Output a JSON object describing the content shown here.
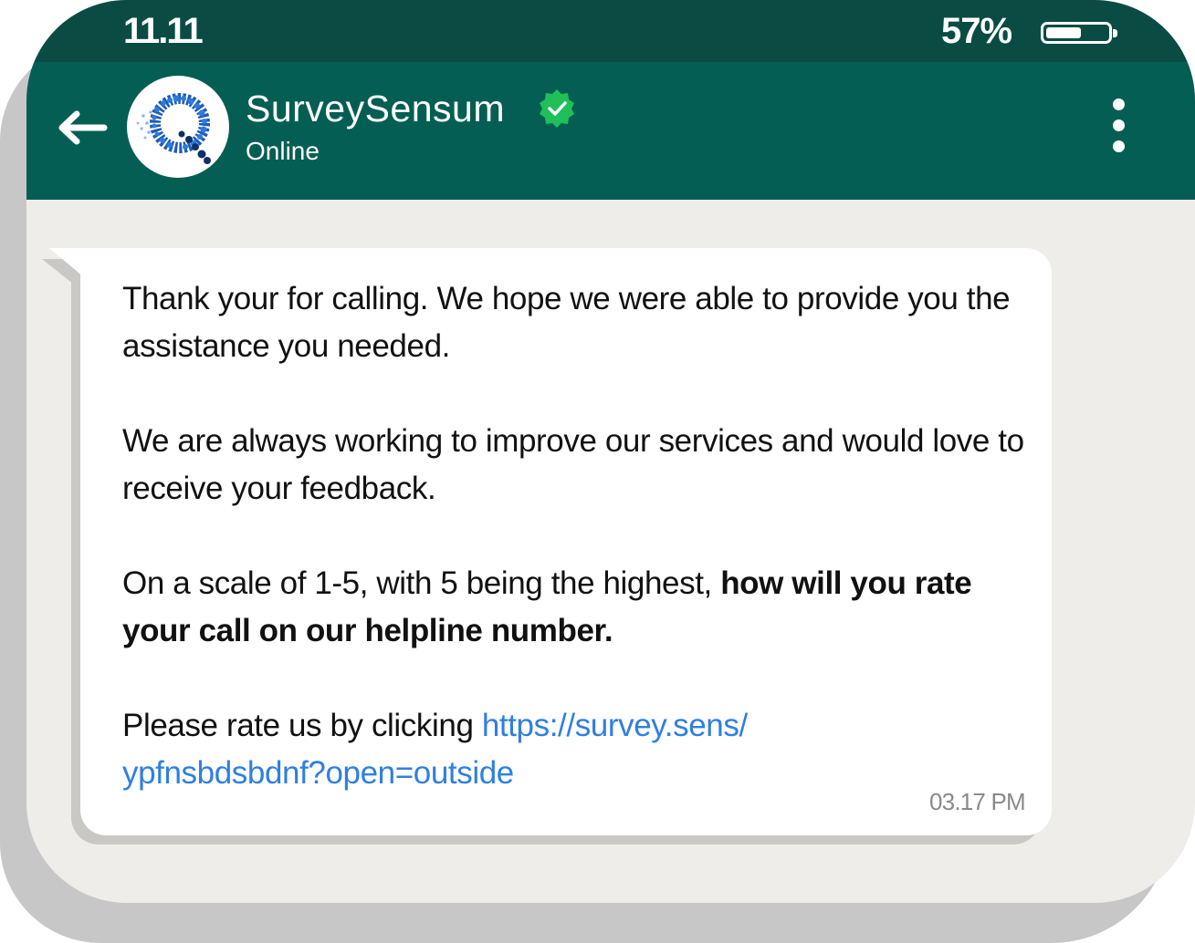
{
  "status_bar": {
    "time": "11.11",
    "battery": "57%",
    "battery_level": 0.57
  },
  "header": {
    "contact_name": "SurveySensum",
    "contact_status": "Online",
    "verified": true,
    "icons": {
      "back": "arrow-left-icon",
      "menu": "more-vertical-icon",
      "verified": "verified-badge-icon"
    }
  },
  "message": {
    "para1": "Thank your for calling. We hope we were able to provide you the assistance you needed.",
    "para2": "We are always working to improve our services and would love to receive your feedback.",
    "para3_normal": "On a scale of 1-5, with 5 being the highest, ",
    "para3_bold": "how will you rate your call on our helpline number.",
    "para4_text": "Please rate us by clicking ",
    "para4_link_line1": "https://survey.sens/",
    "para4_link_line2": "ypfnsbdsbdnf?open=outside",
    "time": "03.17 PM"
  },
  "colors": {
    "status_bar": "#0a4c43",
    "header": "#055e53",
    "chat_bg": "#efedea",
    "link": "#2f7fe0",
    "verified": "#1fbf5a"
  }
}
